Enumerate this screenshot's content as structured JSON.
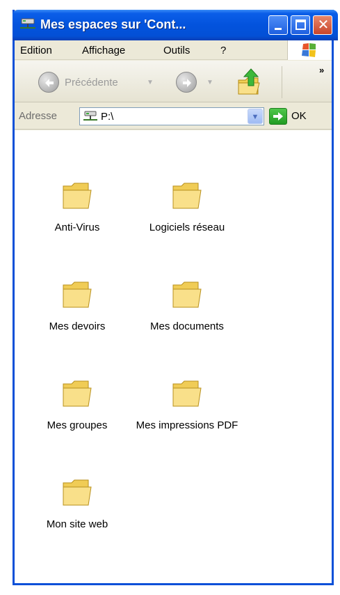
{
  "window": {
    "title": "Mes espaces sur 'Cont...",
    "close_glyph": "✕"
  },
  "menu": [
    "Edition",
    "Affichage",
    "Outils",
    "?"
  ],
  "toolbar": {
    "back_label": "Précédente",
    "more_glyph": "»"
  },
  "address": {
    "label": "Adresse",
    "value": "P:\\",
    "go_label": "OK"
  },
  "folders": [
    {
      "name": "Anti-Virus"
    },
    {
      "name": "Logiciels réseau"
    },
    {
      "name": "Mes devoirs"
    },
    {
      "name": "Mes documents"
    },
    {
      "name": "Mes groupes"
    },
    {
      "name": "Mes impressions PDF"
    },
    {
      "name": "Mon site web"
    }
  ],
  "colors": {
    "titlebar": "#0353dd",
    "window_border": "#0a50d8",
    "chrome": "#ece9d8",
    "folder": "#f9e08a",
    "close_button": "#c8452a",
    "go_button": "#229c23"
  }
}
